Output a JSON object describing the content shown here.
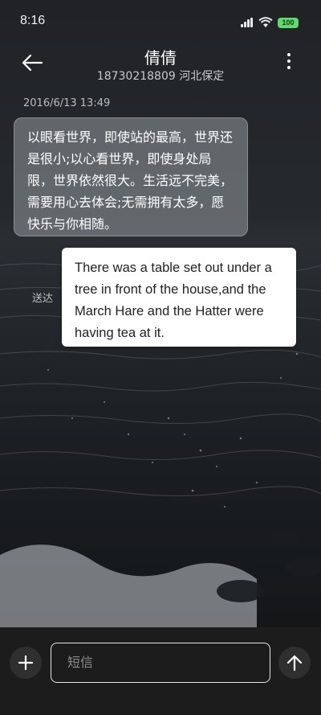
{
  "status_bar": {
    "time": "8:16",
    "battery": "100",
    "icons": [
      "signal-icon",
      "wifi-icon",
      "battery-icon"
    ]
  },
  "header": {
    "contact_name": "倩倩",
    "contact_info": "18730218809 河北保定",
    "back_icon": "back-arrow-icon",
    "more_icon": "more-vertical-icon"
  },
  "conversation": {
    "timestamp": "2016/6/13 13:49",
    "message": "以眼看世界，即使站的最高，世界还是很小;以心看世界，即使身处局限，世界依然很大。生活远不完美，需要用心去体会;无需拥有太多，愿快乐与你相随。",
    "side_label": "送达"
  },
  "translation_popup": {
    "text": "There was a table set out under a tree in front of the house,and the March Hare and the Hatter were having tea at it."
  },
  "composer": {
    "placeholder": "短信",
    "add_icon": "plus-icon",
    "send_icon": "send-arrow-icon"
  },
  "colors": {
    "popup_background": "#ffffff",
    "bubble_background": "#8a8f94",
    "bottom_bar": "#1c1c1c"
  }
}
